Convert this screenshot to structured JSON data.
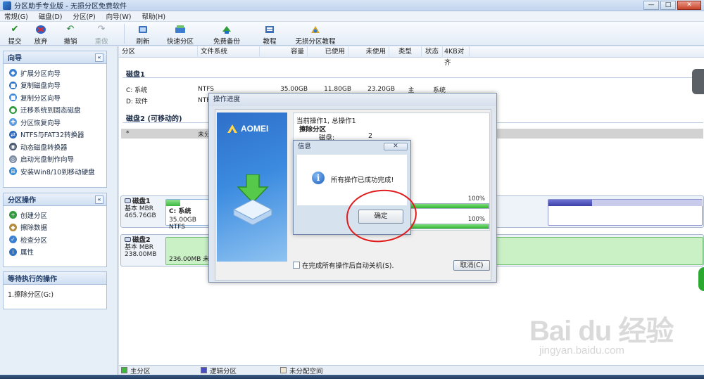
{
  "window": {
    "title": "分区助手专业版 - 无损分区免费软件",
    "controls": {
      "minimize": "—",
      "maximize": "□",
      "close": "✕"
    }
  },
  "menu": [
    "常规(G)",
    "磁盘(D)",
    "分区(P)",
    "向导(W)",
    "帮助(H)"
  ],
  "toolbar": [
    {
      "label": "提交",
      "icon": "check-icon"
    },
    {
      "label": "放弃",
      "icon": "discard-icon"
    },
    {
      "label": "撤销",
      "icon": "undo-icon"
    },
    {
      "label": "重做",
      "icon": "redo-icon"
    },
    {
      "label": "刷新",
      "icon": "refresh-icon"
    },
    {
      "label": "快速分区",
      "icon": "quick-partition-icon"
    },
    {
      "label": "免费备份",
      "icon": "backup-icon"
    },
    {
      "label": "教程",
      "icon": "tutorial-icon"
    },
    {
      "label": "无损分区教程",
      "icon": "lossless-tutorial-icon"
    }
  ],
  "wizard": {
    "title": "向导",
    "collapse": "«",
    "items": [
      "扩展分区向导",
      "复制磁盘向导",
      "复制分区向导",
      "迁移系统到固态磁盘",
      "分区恢复向导",
      "NTFS与FAT32转换器",
      "动态磁盘转换器",
      "启动光盘制作向导",
      "安装Win8/10到移动硬盘"
    ]
  },
  "partition_ops": {
    "title": "分区操作",
    "collapse": "«",
    "items": [
      "创建分区",
      "擦除数据",
      "检查分区",
      "属性"
    ]
  },
  "pending": {
    "title": "等待执行的操作",
    "items": [
      "1.擦除分区(G:)"
    ]
  },
  "table": {
    "headers": [
      "分区",
      "文件系统",
      "容量",
      "已使用",
      "未使用",
      "类型",
      "状态",
      "4KB对齐"
    ],
    "disk1_label": "磁盘1",
    "disk1_rows": [
      {
        "partition": "C: 系统",
        "fs": "NTFS",
        "capacity": "35.00GB",
        "used": "11.80GB",
        "free": "23.20GB",
        "type": "主",
        "status": "系统"
      },
      {
        "partition": "D: 软件",
        "fs": "NTF"
      }
    ],
    "disk2_label": "磁盘2 (可移动的)",
    "disk2_rows": [
      {
        "partition": "*",
        "fs": "未分"
      }
    ]
  },
  "diskmap": {
    "disk1": {
      "name": "磁盘1",
      "kind": "基本 MBR",
      "size": "465.76GB",
      "part_name": "C: 系统",
      "part_desc": "35.00GB NTFS",
      "used_fraction": 0.33
    },
    "disk2": {
      "name": "磁盘2",
      "kind": "基本 MBR",
      "size": "238.00MB",
      "part_desc": "236.00MB 未分"
    }
  },
  "legend": [
    "主分区",
    "逻辑分区",
    "未分配空间"
  ],
  "legend_colors": [
    "#3cba3c",
    "#4a4fc0",
    "#efe6cf"
  ],
  "progress_dialog": {
    "title": "操作进度",
    "logo": "AOMEI",
    "current_op": "当前操作1, 总操作1",
    "op_name": "擦除分区",
    "disk_label": "磁盘:",
    "disk_value": "2",
    "progress1": "100%",
    "progress2": "100%",
    "progress1_value": 1.0,
    "progress2_value": 1.0,
    "shutdown_label": "在完成所有操作后自动关机(S).",
    "cancel_label": "取消(C)"
  },
  "info_dialog": {
    "title": "信息",
    "close": "✕",
    "message": "所有操作已成功完成!",
    "ok_label": "确定"
  },
  "watermark": {
    "main": "Bai du 经验",
    "sub": "jingyan.baidu.com"
  }
}
